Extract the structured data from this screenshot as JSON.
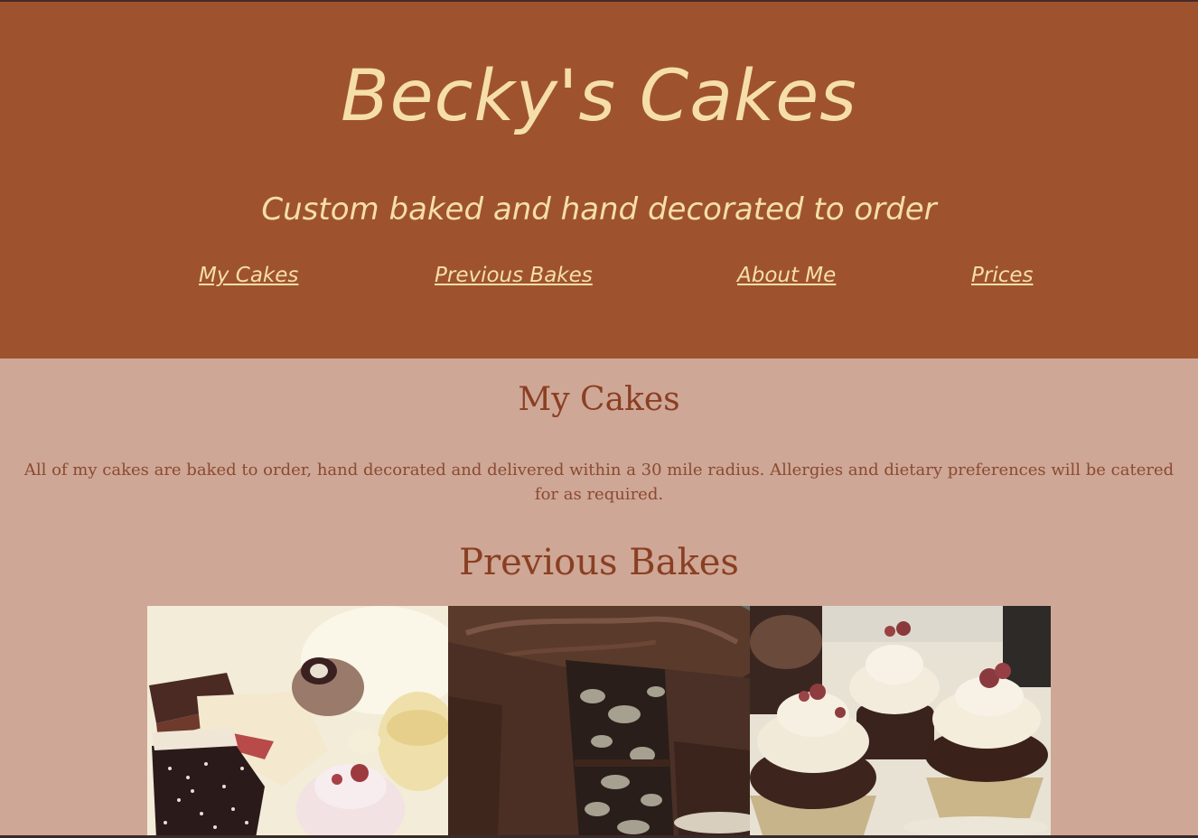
{
  "header": {
    "title": "Becky's Cakes",
    "tagline": "Custom baked and hand decorated to order"
  },
  "nav": {
    "items": [
      {
        "label": "My Cakes"
      },
      {
        "label": "Previous Bakes"
      },
      {
        "label": "About Me"
      },
      {
        "label": "Prices"
      }
    ]
  },
  "my_cakes": {
    "heading": "My Cakes",
    "text": "All of my cakes are baked to order, hand decorated and delivered within a 30 mile radius. Allergies and dietary preferences will be catered for as required."
  },
  "previous_bakes": {
    "heading": "Previous Bakes",
    "photos": [
      {
        "subject": "assorted-pastries-photo"
      },
      {
        "subject": "chocolate-cake-photo"
      },
      {
        "subject": "cupcakes-photo"
      }
    ]
  },
  "colors": {
    "header_bg": "#9e532e",
    "page_bg": "#cfa796",
    "header_text": "#f6deab",
    "heading_text": "#8a3f22"
  }
}
